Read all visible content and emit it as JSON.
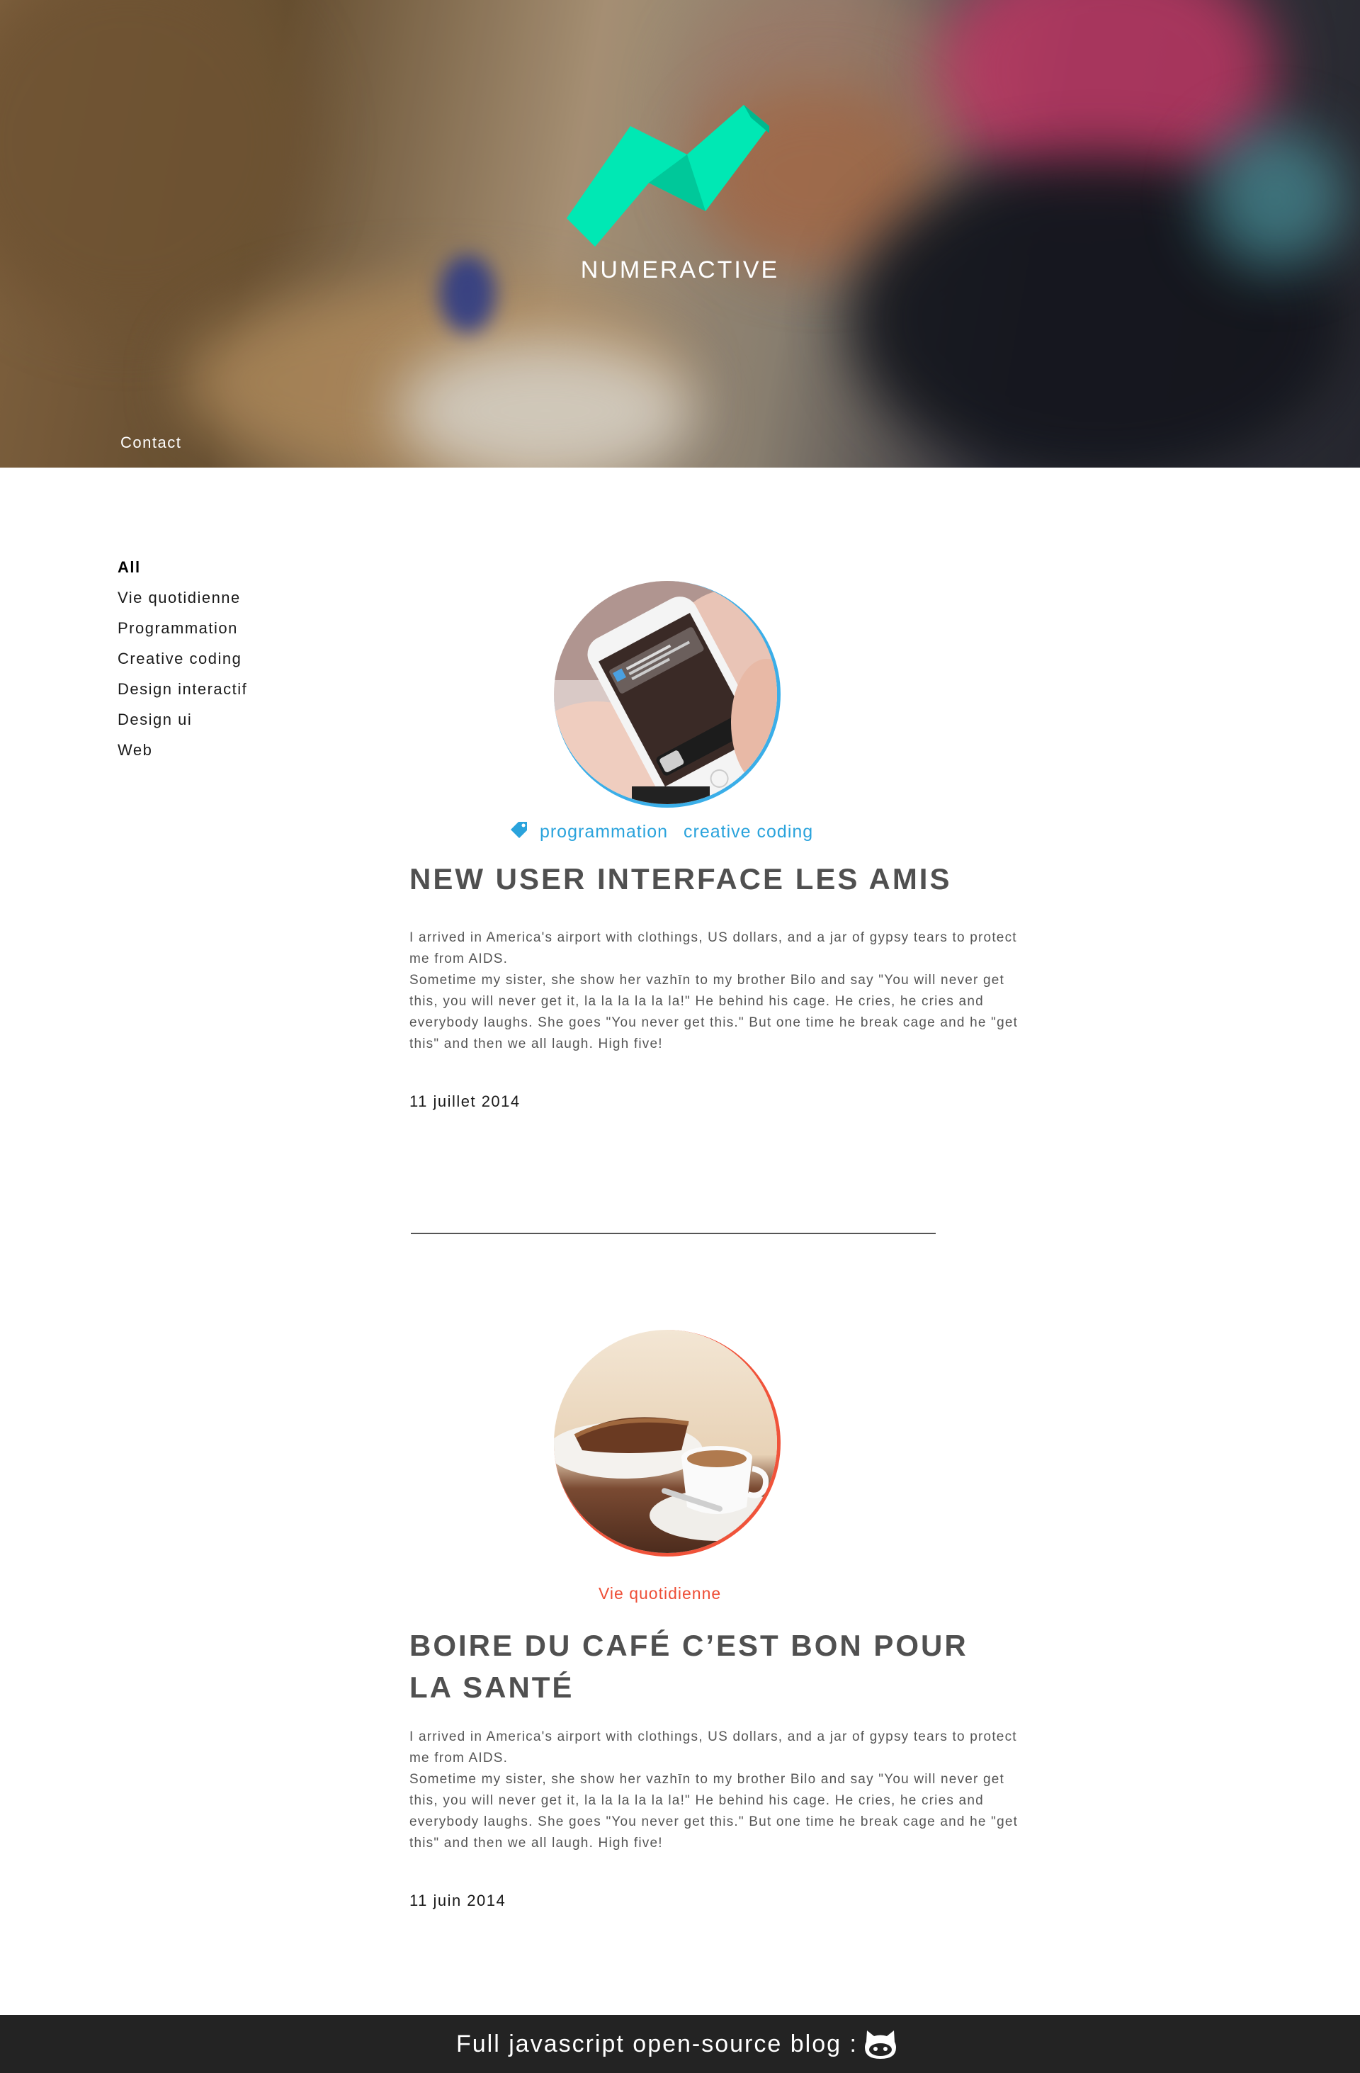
{
  "brand": {
    "name": "NUMERACTIVE",
    "logo_color": "#00E8B4",
    "logo_shade": "#00B88E"
  },
  "nav": {
    "contact_label": "Contact"
  },
  "categories": [
    {
      "label": "All",
      "active": true
    },
    {
      "label": "Vie quotidienne",
      "active": false
    },
    {
      "label": "Programmation",
      "active": false
    },
    {
      "label": "Creative coding",
      "active": false
    },
    {
      "label": "Design interactif",
      "active": false
    },
    {
      "label": "Design ui",
      "active": false
    },
    {
      "label": "Web",
      "active": false
    }
  ],
  "posts": [
    {
      "image": "phone-notification-photo",
      "ring_color": "#3AAEE8",
      "tags": [
        "programmation",
        "creative coding"
      ],
      "tag_color": "#2AA3DC",
      "tag_icon": "tag-icon",
      "title": "New user interface les amis",
      "body": [
        "I arrived in America's airport with clothings, US dollars, and a jar of gypsy tears to protect me from AIDS.",
        "Sometime my sister, she show her vazhīn to my brother Bilo and say \"You will never get this, you will never get it, la la la la la la!\" He behind his cage. He cries, he cries and everybody laughs. She goes \"You never get this.\" But one time he break cage and he \"get this\" and then we all laugh. High five!"
      ],
      "date": "11 juillet 2014"
    },
    {
      "image": "coffee-cup-photo",
      "ring_color": "#F0533A",
      "tags": [
        "Vie quotidienne"
      ],
      "tag_color": "#EE4E36",
      "title": "Boire du café c’est bon pour la santé",
      "body": [
        "I arrived in America's airport with clothings, US dollars, and a jar of gypsy tears to protect me from AIDS.",
        "Sometime my sister, she show her vazhīn to my brother Bilo and say \"You will never get this, you will never get it, la la la la la la!\" He behind his cage. He cries, he cries and everybody laughs. She goes \"You never get this.\" But one time he break cage and he \"get this\" and then we all laugh. High five!"
      ],
      "date": "11 juin 2014"
    }
  ],
  "footer": {
    "text": "Full javascript open-source blog :",
    "icon": "github-icon"
  }
}
